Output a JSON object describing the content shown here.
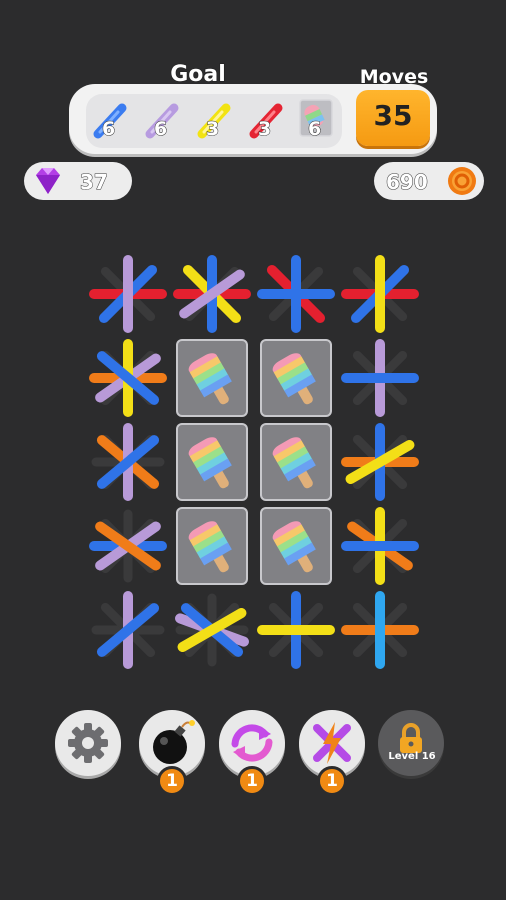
{
  "goal": {
    "title": "Goal",
    "items": [
      {
        "icon": "blue-stick-icon",
        "color": "#3b7cf0",
        "count": "6"
      },
      {
        "icon": "lavender-stick-icon",
        "color": "#b79be0",
        "count": "6"
      },
      {
        "icon": "yellow-stick-icon",
        "color": "#f2e312",
        "count": "3"
      },
      {
        "icon": "red-stick-icon",
        "color": "#e52433",
        "count": "3"
      },
      {
        "icon": "frozen-popsicle-icon",
        "color": "#c8c8c8",
        "count": "6"
      }
    ]
  },
  "moves": {
    "title": "Moves",
    "value": "35"
  },
  "currency": {
    "gems": {
      "icon": "gem-icon",
      "value": "37"
    },
    "coins": {
      "icon": "coin-icon",
      "value": "690"
    }
  },
  "colors": {
    "blue": "#2f73e8",
    "lavender": "#b89ad8",
    "yellow": "#f3df17",
    "red": "#e4202f",
    "orange": "#f07c19",
    "sky": "#2fa7f0",
    "background": "#2c2c2d",
    "accent": "#f59a12"
  },
  "tools": [
    {
      "name": "settings",
      "icon": "gear-icon",
      "badge": ""
    },
    {
      "name": "bomb",
      "icon": "bomb-icon",
      "badge": "1"
    },
    {
      "name": "shuffle",
      "icon": "shuffle-icon",
      "badge": "1"
    },
    {
      "name": "strike",
      "icon": "cross-strike-icon",
      "badge": "1"
    },
    {
      "name": "locked",
      "icon": "lock-icon",
      "label": "Level 16"
    }
  ]
}
